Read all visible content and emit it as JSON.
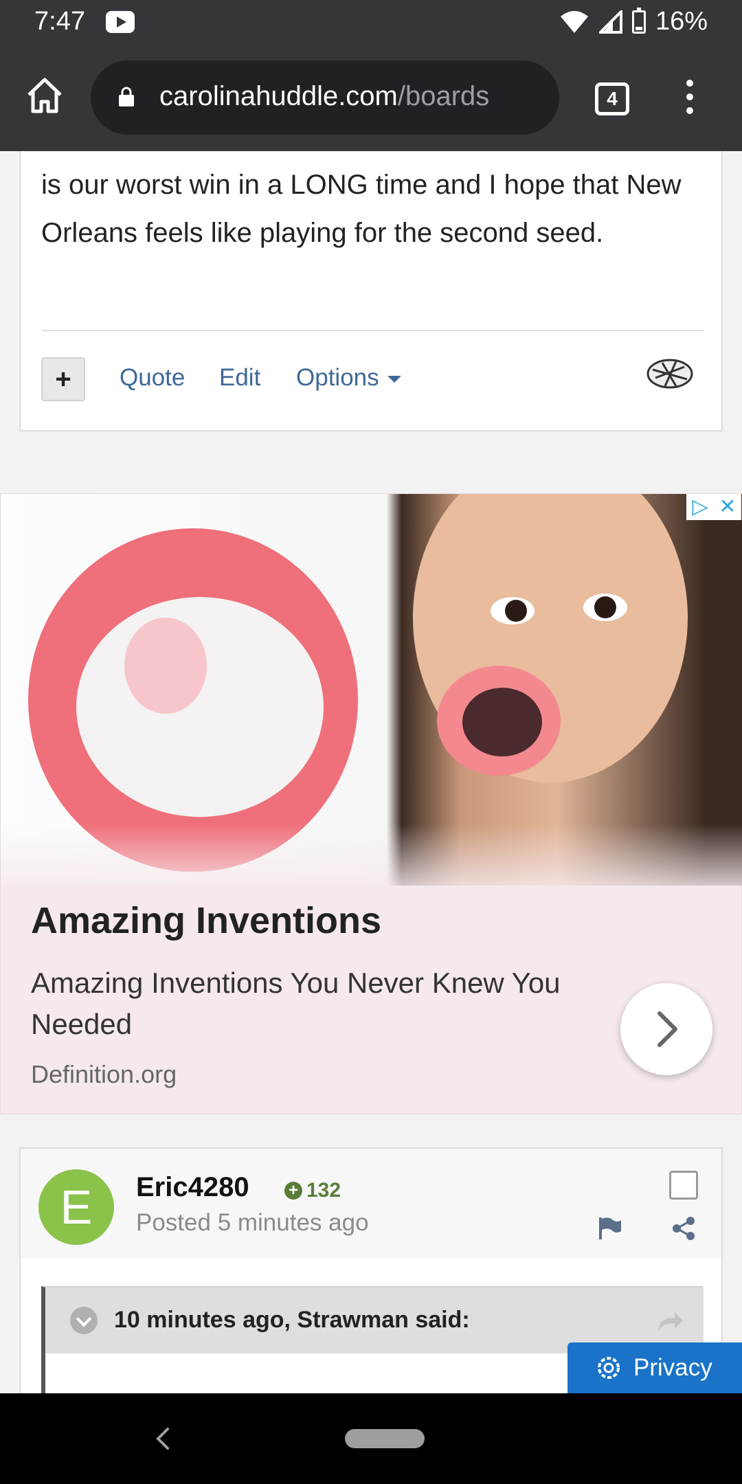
{
  "status_bar": {
    "time": "7:47",
    "battery": "16%"
  },
  "browser": {
    "url_host": "carolinahuddle.com",
    "url_path": "/boards",
    "tab_count": "4"
  },
  "post1": {
    "text": "is our worst win in a LONG time and I hope that New Orleans feels like playing for the second seed.",
    "plus_label": "+",
    "quote_label": "Quote",
    "edit_label": "Edit",
    "options_label": "Options"
  },
  "ad": {
    "title": "Amazing Inventions",
    "description": "Amazing Inventions You Never Knew You Needed",
    "source": "Definition.org",
    "close_label": "✕",
    "adchoices_label": "▷"
  },
  "post2": {
    "avatar_letter": "E",
    "username": "Eric4280",
    "reputation": "132",
    "rep_icon": "+",
    "posted": "Posted 5 minutes ago",
    "quote_author": "10 minutes ago, Strawman said:"
  },
  "privacy": {
    "label": "Privacy"
  },
  "colors": {
    "toolbar": "#35363a",
    "link": "#3e6897",
    "avatar": "#8bc34a",
    "privacy": "#1a73c8"
  }
}
